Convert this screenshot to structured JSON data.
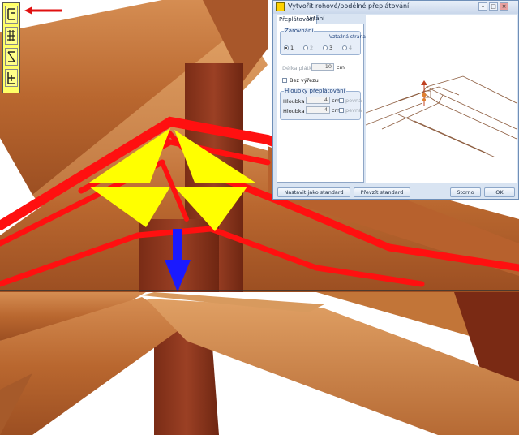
{
  "dialog": {
    "title": "Vytvořit rohové/podélné přeplátování",
    "tabs": [
      {
        "label": "Přeplátování",
        "active": true
      },
      {
        "label": "Vrtání",
        "active": false
      }
    ],
    "zarovnani": {
      "group_label": "Zarovnání",
      "side_label": "Vztažná strana",
      "options": [
        "1",
        "2",
        "3",
        "4"
      ],
      "selected": "1"
    },
    "delka_platku": {
      "label": "Délka plátku:",
      "value": "10",
      "unit": "cm"
    },
    "bez_vyrezu": {
      "label": "Bez výřezu",
      "checked": false
    },
    "hloubky": {
      "group_label": "Hloubky přeplátování",
      "rows": [
        {
          "label": "Hloubka 1:",
          "value": "4",
          "unit": "cm",
          "check_label": "pevná"
        },
        {
          "label": "Hloubka 2:",
          "value": "4",
          "unit": "cm",
          "check_label": "pevná"
        }
      ]
    },
    "buttons": {
      "set_default": "Nastavit jako standard",
      "take_default": "Převzít standard",
      "cancel": "Storno",
      "ok": "OK"
    }
  },
  "toolbar": {
    "icons": [
      "corner-lap-icon",
      "longitudinal-lap-icon",
      "cross-lap-icon",
      "lap-end-icon"
    ]
  },
  "colors": {
    "wood_light": "#c7793f",
    "wood_dark": "#8e3a1e",
    "highlight_red": "#ff1010",
    "highlight_yellow": "#ffff00",
    "arrow_blue": "#1a1aff",
    "dialog_bg": "#d9e4f2",
    "dialog_accent": "#1b3f7a"
  }
}
